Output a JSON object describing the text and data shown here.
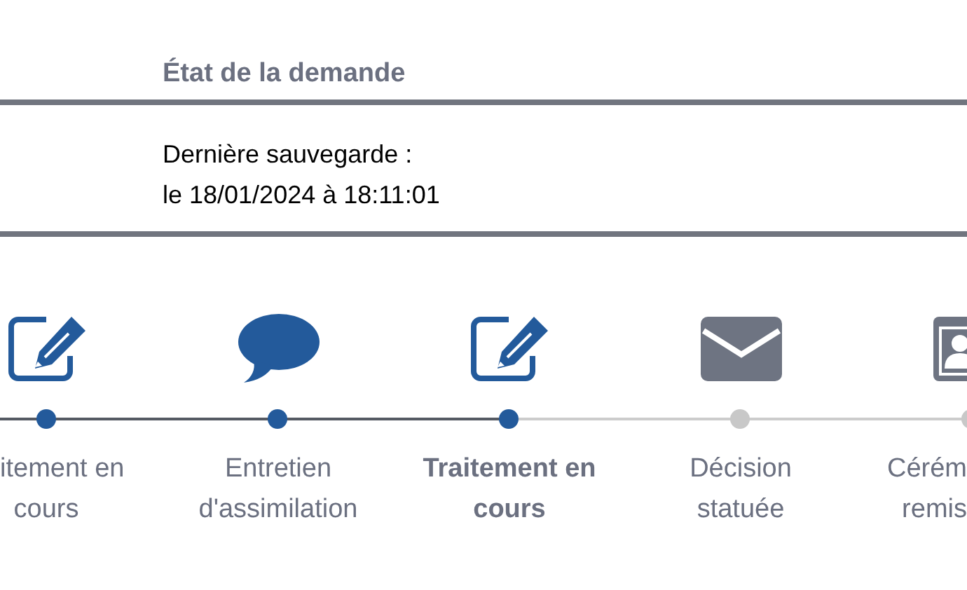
{
  "request_state": {
    "title": "État de la demande",
    "last_save_label": "Dernière sauvegarde :",
    "last_save_value": "le 18/01/2024 à 18:11:01"
  },
  "steps": [
    {
      "kind": "edit",
      "reached": true,
      "selected": false,
      "lines": [
        "itement en",
        "cours"
      ]
    },
    {
      "kind": "chat",
      "reached": true,
      "selected": false,
      "lines": [
        "Entretien",
        "d'assimilation"
      ]
    },
    {
      "kind": "edit",
      "reached": true,
      "selected": true,
      "lines": [
        "Traitement en",
        "cours"
      ]
    },
    {
      "kind": "mail",
      "reached": false,
      "selected": false,
      "lines": [
        "Décision",
        "statuée"
      ]
    },
    {
      "kind": "contact",
      "reached": false,
      "selected": false,
      "lines": [
        "Cérém",
        "remis"
      ]
    }
  ]
}
